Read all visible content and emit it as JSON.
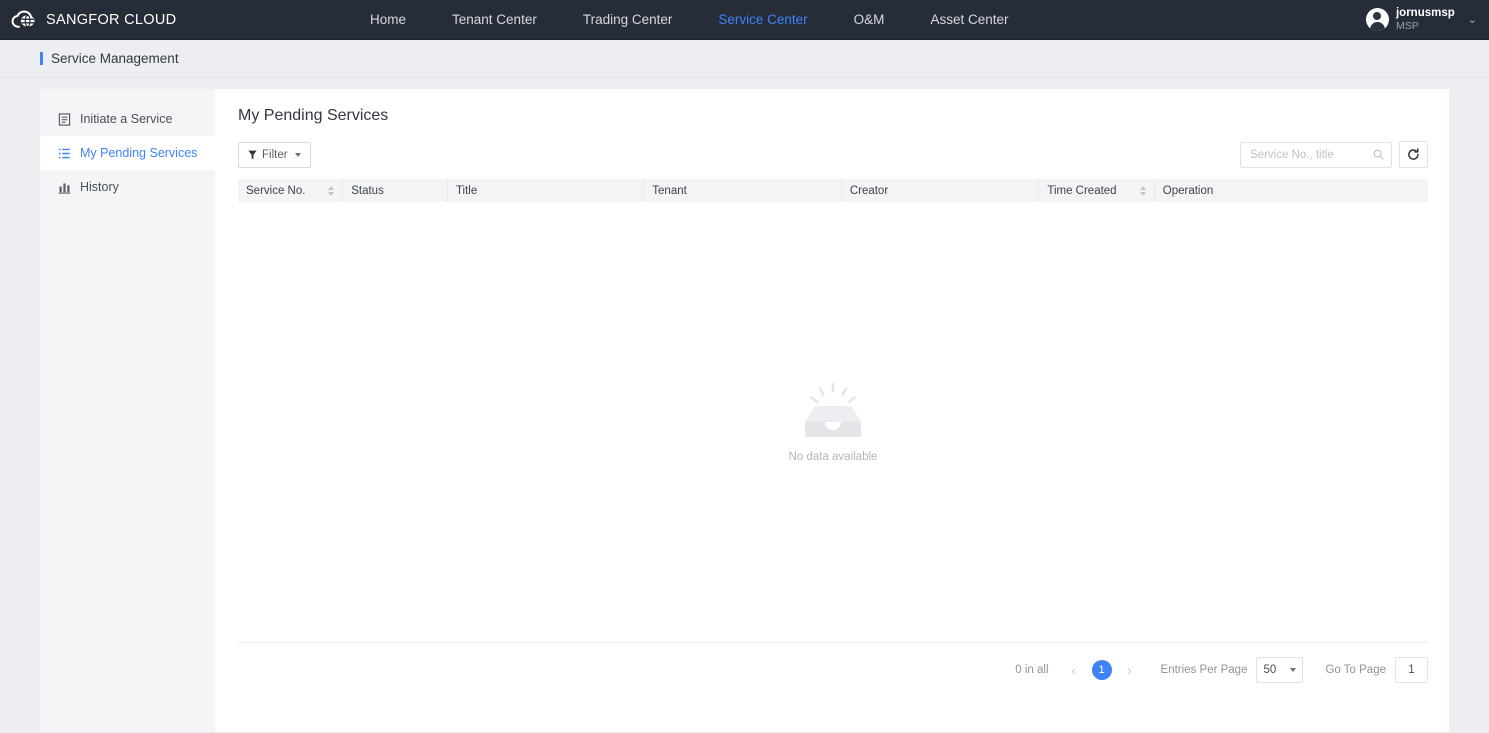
{
  "header": {
    "brand": "SANGFOR CLOUD",
    "logo_icon": "cloud-logo-icon",
    "nav": [
      {
        "label": "Home",
        "active": false
      },
      {
        "label": "Tenant Center",
        "active": false
      },
      {
        "label": "Trading Center",
        "active": false
      },
      {
        "label": "Service Center",
        "active": true
      },
      {
        "label": "O&M",
        "active": false
      },
      {
        "label": "Asset Center",
        "active": false
      }
    ],
    "user": {
      "name": "jornusmsp",
      "role": "MSP",
      "caret": "⌄"
    },
    "colors": {
      "background": "#262c38",
      "accent": "#3f84f6"
    }
  },
  "breadcrumb": {
    "label": "Service Management"
  },
  "sidebar": {
    "items": [
      {
        "label": "Initiate a Service",
        "icon": "document-icon",
        "active": false
      },
      {
        "label": "My Pending Services",
        "icon": "list-icon",
        "active": true
      },
      {
        "label": "History",
        "icon": "bar-chart-icon",
        "active": false
      }
    ]
  },
  "main": {
    "title": "My Pending Services",
    "toolbar": {
      "filter_label": "Filter",
      "filter_icon": "funnel-icon",
      "search_placeholder": "Service No., title",
      "search_value": "",
      "search_icon": "search-icon",
      "refresh_icon": "refresh-icon"
    },
    "table": {
      "columns": [
        {
          "label": "Service No.",
          "sortable": true
        },
        {
          "label": "Status",
          "sortable": false
        },
        {
          "label": "Title",
          "sortable": false
        },
        {
          "label": "Tenant",
          "sortable": false
        },
        {
          "label": "Creator",
          "sortable": false
        },
        {
          "label": "Time Created",
          "sortable": true
        },
        {
          "label": "Operation",
          "sortable": false
        }
      ],
      "rows": [],
      "empty_text": "No data available",
      "empty_icon": "empty-box-icon"
    },
    "pagination": {
      "total_text": "0 in all",
      "prev_icon": "chevron-left-icon",
      "next_icon": "chevron-right-icon",
      "current_page": "1",
      "per_page_label": "Entries Per Page",
      "per_page_value": "50",
      "goto_label": "Go To Page",
      "goto_value": "1"
    }
  }
}
